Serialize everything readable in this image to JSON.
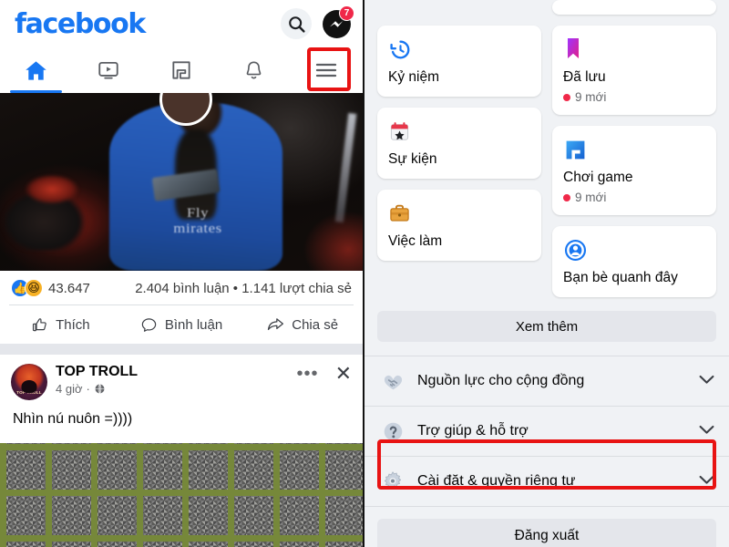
{
  "left": {
    "header": {
      "logo": "facebook",
      "search_icon": "search-icon",
      "messenger_icon": "messenger-icon",
      "messenger_badge": "7"
    },
    "nav_tabs": [
      {
        "name": "home",
        "icon": "home-icon",
        "active": true
      },
      {
        "name": "watch",
        "icon": "video-icon",
        "active": false
      },
      {
        "name": "gaming",
        "icon": "gaming-icon",
        "active": false
      },
      {
        "name": "notifications",
        "icon": "bell-icon",
        "active": false
      },
      {
        "name": "menu",
        "icon": "hamburger-icon",
        "active": false
      }
    ],
    "video_post": {
      "jersey_text_line1": "Fly",
      "jersey_text_line2": "mirates",
      "reactions": {
        "like_glyph": "👍",
        "haha_glyph": "😆",
        "count": "43.647"
      },
      "comments_shares": "2.404 bình luận • 1.141 lượt chia sẻ",
      "actions": [
        {
          "name": "like",
          "label": "Thích",
          "icon": "thumbs-up-icon"
        },
        {
          "name": "comment",
          "label": "Bình luận",
          "icon": "comment-bubble-icon"
        },
        {
          "name": "share",
          "label": "Chia sẻ",
          "icon": "share-arrow-icon"
        }
      ]
    },
    "post": {
      "avatar_label": "TOP TROLL",
      "author": "TOP TROLL",
      "time": "4 giờ",
      "separator": "·",
      "privacy_icon": "globe-icon",
      "more_icon": "more-dots-icon",
      "close_icon": "close-icon",
      "body": "Nhìn nú nuôn =))))"
    }
  },
  "right": {
    "shortcuts_left": [
      {
        "name": "memories",
        "icon": "clock-history-icon",
        "label": "Kỷ niệm"
      },
      {
        "name": "events",
        "icon": "calendar-star-icon",
        "label": "Sự kiện"
      },
      {
        "name": "jobs",
        "icon": "briefcase-icon",
        "label": "Việc làm"
      }
    ],
    "shortcuts_right": [
      {
        "name": "saved",
        "icon": "bookmark-icon",
        "label": "Đã lưu",
        "badge": "9 mới"
      },
      {
        "name": "play-games",
        "icon": "gaming-icon",
        "label": "Chơi game",
        "badge": "9 mới"
      },
      {
        "name": "nearby-friends",
        "icon": "nearby-friends-icon",
        "label": "Bạn bè quanh đây",
        "badge": ""
      }
    ],
    "see_more_label": "Xem thêm",
    "menu_rows": [
      {
        "name": "community-resources",
        "icon": "handshake-heart-icon",
        "label": "Nguồn lực cho cộng đồng",
        "highlighted": false
      },
      {
        "name": "help-support",
        "icon": "question-mark-icon",
        "label": "Trợ giúp & hỗ trợ",
        "highlighted": false
      },
      {
        "name": "settings-privacy",
        "icon": "gear-icon",
        "label": "Cài đặt & quyền riêng tư",
        "highlighted": true
      }
    ],
    "logout_label": "Đăng xuất"
  },
  "annotations": {
    "highlight_color": "#E81313",
    "targets": [
      "hamburger-menu-button",
      "settings-privacy-row"
    ]
  },
  "colors": {
    "brand_blue": "#1877F2",
    "badge_red": "#F02849",
    "panel_grey": "#F0F2F5",
    "highlight_red": "#E81313"
  }
}
